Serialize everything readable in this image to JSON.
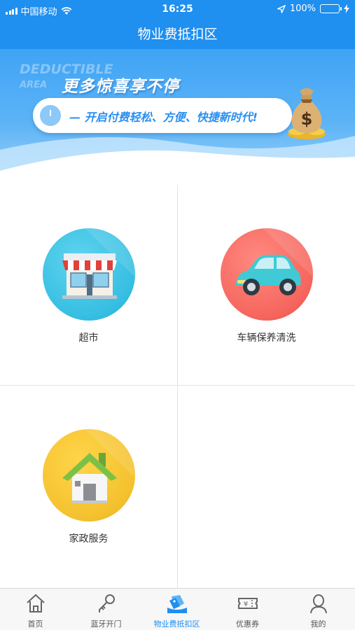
{
  "status_bar": {
    "carrier": "中国移动",
    "time": "16:25",
    "battery": "100%",
    "icons": [
      "signal-icon",
      "wifi-icon",
      "location-icon",
      "battery-icon",
      "charging-icon"
    ]
  },
  "nav": {
    "title": "物业费抵扣区"
  },
  "banner": {
    "en_line1": "DEDUCTIBLE",
    "en_line2": "AREA",
    "title": "更多惊喜享不停",
    "slogan": "— 开启付费轻松、方便、快捷新时代!",
    "icons": [
      "clock-icon",
      "money-bag-icon"
    ]
  },
  "services": [
    {
      "label": "超市",
      "icon": "supermarket-icon",
      "color": "#36bee2"
    },
    {
      "label": "车辆保养清洗",
      "icon": "car-icon",
      "color": "#f5655d"
    },
    {
      "label": "家政服务",
      "icon": "house-icon",
      "color": "#f4c12e"
    }
  ],
  "tabbar": {
    "active_color": "#1f8ff0",
    "items": [
      {
        "label": "首页",
        "icon": "home-icon",
        "active": false
      },
      {
        "label": "蓝牙开门",
        "icon": "key-icon",
        "active": false
      },
      {
        "label": "物业费抵扣区",
        "icon": "deduction-tag-icon",
        "active": true
      },
      {
        "label": "优惠券",
        "icon": "coupon-icon",
        "active": false
      },
      {
        "label": "我的",
        "icon": "user-icon",
        "active": false
      }
    ]
  }
}
